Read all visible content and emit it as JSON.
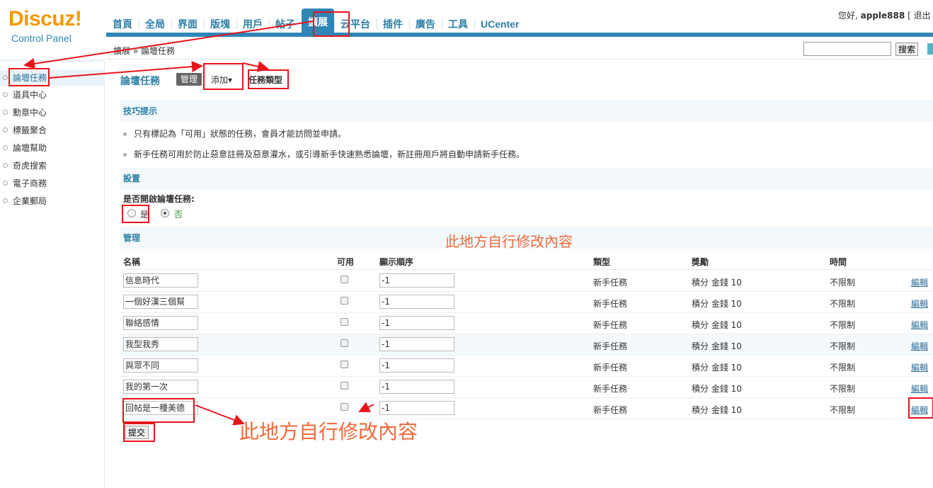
{
  "header": {
    "logo_text": "Discuz!",
    "logo_sub": "Control Panel",
    "user_greeting": "您好,",
    "username": "apple888",
    "logout_fragment": "[ 退出"
  },
  "nav": {
    "items": [
      "首頁",
      "全局",
      "界面",
      "版塊",
      "用戶",
      "帖子",
      "擴展",
      "云平台",
      "插件",
      "廣告",
      "工具",
      "UCenter"
    ],
    "active": "擴展"
  },
  "breadcrumb": "擴展 » 論壇任務",
  "search": {
    "value": "",
    "button_label": "搜索"
  },
  "sidebar": {
    "items": [
      "論壇任務",
      "道具中心",
      "勳章中心",
      "標籤聚合",
      "論壇幫助",
      "奇虎搜索",
      "電子商務",
      "企業郵局"
    ],
    "active": "論壇任務"
  },
  "page": {
    "title": "論壇任務",
    "tabs": {
      "manage": "管理",
      "add": "添加▾",
      "types": "任務類型"
    }
  },
  "tips": {
    "heading": "技巧提示",
    "lines": [
      "只有標記為「可用」狀態的任務，會員才能訪問並申請。",
      "新手任務可用於防止惡意註冊及惡意灌水，或引導新手快速熟悉論壇，新註冊用戶將自動申請新手任務。"
    ]
  },
  "settings": {
    "heading": "設置",
    "label": "是否開啟論壇任務:",
    "yes": "是",
    "no": "否",
    "selected": "否"
  },
  "manage": {
    "heading": "管理",
    "columns": {
      "name": "名稱",
      "enabled": "可用",
      "order": "顯示順序",
      "type": "類型",
      "reward": "獎勵",
      "time": "時間"
    },
    "rows": [
      {
        "name": "信息時代",
        "enabled": false,
        "order": "-1",
        "type": "新手任務",
        "reward": "積分 金錢 10",
        "time": "不限制",
        "action": "編輯"
      },
      {
        "name": "一個好漢三個幫",
        "enabled": false,
        "order": "-1",
        "type": "新手任務",
        "reward": "積分 金錢 10",
        "time": "不限制",
        "action": "編輯"
      },
      {
        "name": "聯絡感情",
        "enabled": false,
        "order": "-1",
        "type": "新手任務",
        "reward": "積分 金錢 10",
        "time": "不限制",
        "action": "編輯"
      },
      {
        "name": "我型我秀",
        "enabled": false,
        "order": "-1",
        "type": "新手任務",
        "reward": "積分 金錢 10",
        "time": "不限制",
        "action": "編輯"
      },
      {
        "name": "與眾不同",
        "enabled": false,
        "order": "-1",
        "type": "新手任務",
        "reward": "積分 金錢 10",
        "time": "不限制",
        "action": "編輯"
      },
      {
        "name": "我的第一次",
        "enabled": false,
        "order": "-1",
        "type": "新手任務",
        "reward": "積分 金錢 10",
        "time": "不限制",
        "action": "編輯"
      },
      {
        "name": "回帖是一種美德",
        "enabled": false,
        "order": "-1",
        "type": "新手任務",
        "reward": "積分 金錢 10",
        "time": "不限制",
        "action": "編輯"
      }
    ],
    "submit_label": "提交"
  },
  "annotations": {
    "note_upper": "此地方自行修改內容",
    "note_lower": "此地方自行修改內容",
    "color": "#f06a3a",
    "box_color": "#e8141c"
  },
  "colors": {
    "accent": "#2f86b6",
    "logo": "#f39800",
    "section_bg": "#f2f8fb"
  }
}
